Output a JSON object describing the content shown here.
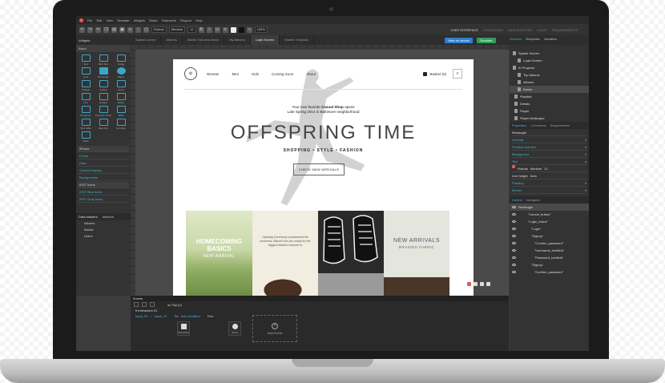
{
  "app": {
    "menu": [
      "File",
      "Edit",
      "View",
      "Simulate",
      "Widgets",
      "Share",
      "Teamwork",
      "Plug-ins",
      "Help"
    ],
    "toolbar": {
      "font": "Roboto",
      "weight": "Medium",
      "size": "12",
      "zoom": "100%"
    },
    "modes": [
      "USER INTERFACE",
      "CONDITIONS",
      "DATA MASTERS",
      "LOGIC",
      "REQUIREMENTS"
    ],
    "active_mode": "USER INTERFACE",
    "page_tabs": [
      "Splash screen",
      "Albums",
      "Mobile Tab-view-items",
      "My Albums",
      "Login Screen",
      "Master Template"
    ],
    "active_tab": "Login Screen",
    "view_in_device": "View on device",
    "simulate": "Simulate",
    "right_top_tabs": [
      "Screens",
      "Templates",
      "Variables"
    ]
  },
  "left": {
    "widgets_title": "Widgets",
    "basic_label": "Basic",
    "widgets": [
      "Text",
      "Rich Text",
      "Image",
      "Input",
      "Rectangle",
      "Ellipse",
      "Triangle",
      "Callout",
      "Arrow",
      "Line",
      "Hotspot",
      "Button",
      "Dropdown",
      "Dynamic Panel",
      "Table",
      "Text Table",
      "Data Grid",
      "Summary",
      "Video"
    ],
    "sections": [
      "iPhone",
      "Forms",
      "Data",
      "Content display",
      "Backgrounds",
      "iOS7 Icons",
      "iOS7 Blue icons",
      "iOS7 Gray icons"
    ],
    "data_masters_tab": "Data Masters",
    "masters_tab": "Masters",
    "data_masters": [
      "Albums",
      "Bands",
      "Users"
    ]
  },
  "page": {
    "nav": [
      "Woman",
      "Men",
      "Kids",
      "Coming Soon",
      "About"
    ],
    "basket": "Basket (0)",
    "intro_line1_a": "Your new favorite ",
    "intro_line1_b": "Casual Shop",
    "intro_line1_c": " opens",
    "intro_line2": "Late Spring 2014 in Baltimore neighborhood",
    "hero_title": "OFFSPRING TIME",
    "categories": "SHOPPING  •  STYLE  •  FASHION",
    "check_button": "CHECK NEW ARRIVALS",
    "tile1_title": "HOMECOMING BASICS",
    "tile1_sub": "NEW ARRIVAL",
    "tile2_body": "Opening Ceremony scholarsend the tomorrow, Mauris! Are you ready for the biggest fashion moment in",
    "tile4_title": "NEW ARRIVALS",
    "tile4_sub": "BRAIDED FABRIC"
  },
  "right": {
    "screens": [
      "Splash Screen",
      "Login Screen",
      "In Progress",
      "Top Albums",
      "Albums",
      "Bands",
      "Playlists",
      "Details",
      "Player",
      "Player landscape"
    ],
    "props_tabs": [
      "Properties",
      "Comments",
      "Requirements"
    ],
    "element": "Rectangle",
    "prop_rows": [
      "General",
      "Position and size",
      "Background",
      "Text"
    ],
    "text_font": "Roboto",
    "text_weight": "Medium",
    "text_size": "12",
    "line_height_label": "Line height",
    "line_height": "Auto",
    "more_rows": [
      "Padding",
      "Border"
    ],
    "outline_tabs": [
      "Outline",
      "Navigator"
    ],
    "outline": [
      "Rectangle",
      "\"Cancel_button\"",
      "\"Login_frame\"",
      "\"Login\"",
      "\"Signup\"",
      "\"Confirm_password\"",
      "\"Username_textfield\"",
      "\"Password_textfield\"",
      "\"Signup\"",
      "\"Confirm_password\""
    ]
  },
  "events": {
    "title": "Events",
    "tab": "on Tap (1)",
    "interaction": "Interaction 01",
    "cond_a": "Input_01",
    "cond_b": "Input_12",
    "do_label": "Do",
    "then_label": "Else",
    "add_condition": "Add condition",
    "action1": "Set Active",
    "action2": "Show",
    "add_event": "Add Event"
  }
}
